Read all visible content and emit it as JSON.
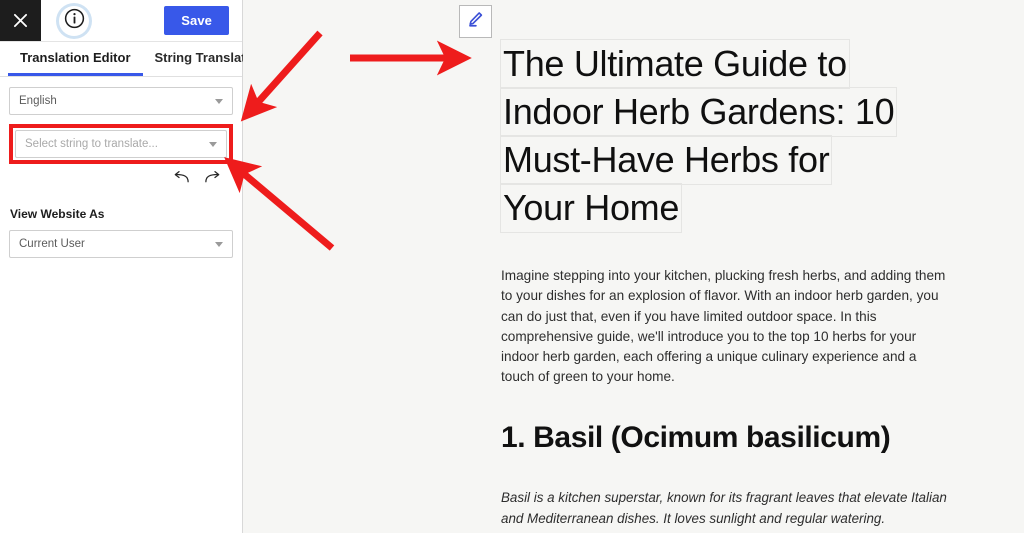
{
  "colors": {
    "accent_blue": "#3858e9",
    "annotation_red": "#ee1c1c",
    "close_button_bg": "#1d1d1d",
    "content_bg": "#f6f6f4",
    "sidebar_bg": "#ffffff"
  },
  "sidebar": {
    "topbar": {
      "close_label": "close-icon",
      "info_label": "info-icon",
      "save_label": "Save"
    },
    "tabs": [
      {
        "label": "Translation Editor",
        "active": true
      },
      {
        "label": "String Translation",
        "active": false
      }
    ],
    "language_select": {
      "value": "English"
    },
    "string_select": {
      "placeholder": "Select string to translate...",
      "value": "Select string to translate..."
    },
    "history": {
      "undo_label": "undo-icon",
      "redo_label": "redo-icon"
    },
    "view_website_as": {
      "label": "View Website As",
      "value": "Current User"
    }
  },
  "content": {
    "edit_button_label": "pencil-icon",
    "title_lines": [
      "The Ultimate Guide to",
      "Indoor Herb Gardens: 10",
      "Must-Have Herbs for",
      "Your Home"
    ],
    "intro_paragraph": "Imagine stepping into your kitchen, plucking fresh herbs, and adding them to your dishes for an explosion of flavor. With an indoor herb garden, you can do just that, even if you have limited outdoor space. In this comprehensive guide, we'll introduce you to the top 10 herbs for your indoor herb garden, each offering a unique culinary experience and a touch of green to your home.",
    "section_heading": "1. Basil (Ocimum basilicum)",
    "section_paragraph": "Basil is a kitchen superstar, known for its fragrant leaves that elevate Italian and Mediterranean dishes. It loves sunlight and regular watering."
  },
  "annotations": [
    {
      "name": "arrow-to-string-select",
      "direction": "down-left"
    },
    {
      "name": "arrow-to-edit-pencil",
      "direction": "right"
    },
    {
      "name": "arrow-to-redo-button",
      "direction": "up-left"
    }
  ]
}
